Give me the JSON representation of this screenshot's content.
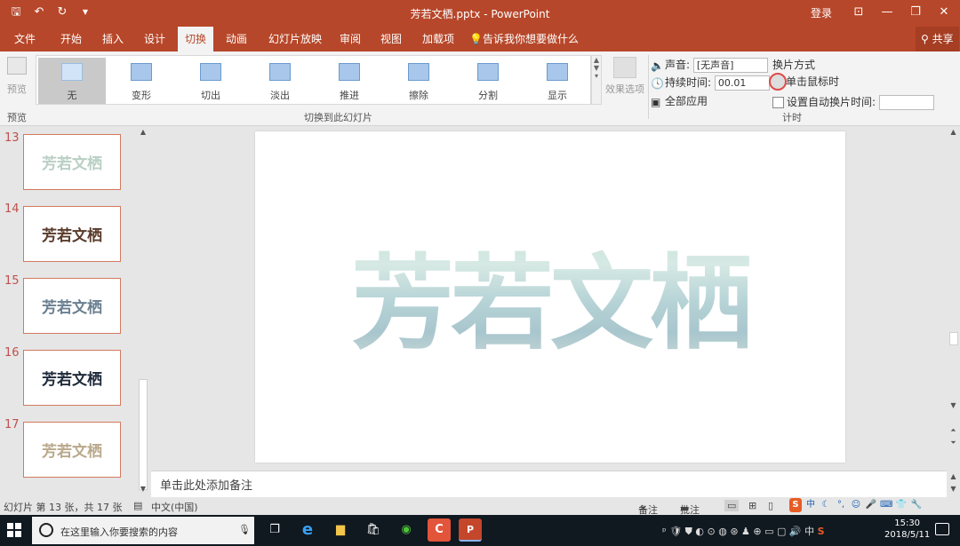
{
  "title": "芳若文栖.pptx - PowerPoint",
  "titlebar": {
    "login": "登录",
    "minimize": "—",
    "restore": "❐",
    "close": "✕",
    "ribbon_opts": "⊡"
  },
  "qat": {
    "save": "🖫",
    "undo": "↶",
    "redo": "↻",
    "custom": "▼"
  },
  "menu": {
    "tabs": [
      "文件",
      "开始",
      "插入",
      "设计",
      "切换",
      "动画",
      "幻灯片放映",
      "审阅",
      "视图",
      "加载项"
    ],
    "active": "切换",
    "tellme": "告诉我你想要做什么",
    "share": "共享"
  },
  "ribbon": {
    "preview_label": "预览",
    "preview_group": "预览",
    "gallery_group": "切换到此幻灯片",
    "transitions": [
      "无",
      "变形",
      "切出",
      "淡出",
      "推进",
      "擦除",
      "分割",
      "显示"
    ],
    "selected": "无",
    "effect_options": "效果选项",
    "timing_group": "计时",
    "sound_label": "声音:",
    "sound_value": "[无声音]",
    "duration_label": "持续时间:",
    "duration_value": "00.01",
    "apply_all": "全部应用",
    "advance_heading": "换片方式",
    "on_click": "单击鼠标时",
    "after_time": "设置自动换片时间:"
  },
  "slides": [
    {
      "number": "13",
      "text": "芳若文栖",
      "color": "#b9cfc4"
    },
    {
      "number": "14",
      "text": "芳若文栖",
      "color": "#5a3b2a"
    },
    {
      "number": "15",
      "text": "芳若文栖",
      "color": "#6a7f91"
    },
    {
      "number": "16",
      "text": "芳若文栖",
      "color": "#1e2a3a"
    },
    {
      "number": "17",
      "text": "芳若文栖",
      "color": "#b9a98c"
    }
  ],
  "main_slide": {
    "text": "芳若文栖"
  },
  "notes_placeholder": "单击此处添加备注",
  "status": {
    "slide_info": "幻灯片 第 13 张，共 17 张",
    "language": "中文(中国)",
    "notes": "备注",
    "comments": "批注"
  },
  "ime": [
    "S",
    "中",
    "☾",
    "°,",
    "☺",
    "🎤",
    "⌨",
    "👕",
    "🔧"
  ],
  "taskbar": {
    "search_placeholder": "在这里输入你要搜索的内容",
    "time": "15:30",
    "date": "2018/5/11",
    "tray_lang": "中",
    "tray_ime": "S"
  }
}
